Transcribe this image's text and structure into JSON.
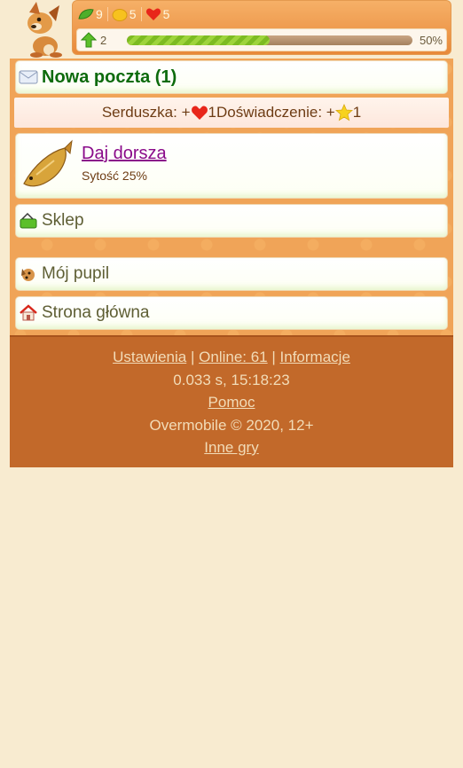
{
  "header": {
    "resources": [
      {
        "icon": "leaf-icon",
        "value": "9"
      },
      {
        "icon": "coin-icon",
        "value": "5"
      },
      {
        "icon": "heart-icon",
        "value": "5"
      }
    ],
    "level": "2",
    "progress_percent": 50,
    "progress_label": "50%"
  },
  "mail": {
    "title": "Nowa poczta (1)"
  },
  "notice": {
    "prefix": "Serduszka: +",
    "hearts": "1",
    "middle": " Doświadczenie: +",
    "exp": "1"
  },
  "food": {
    "title": "Daj dorsza",
    "subtitle": "Sytość 25%"
  },
  "menu": {
    "shop": "Sklep",
    "pet": "Mój pupil",
    "home": "Strona główna"
  },
  "footer": {
    "settings": "Ustawienia",
    "separator": "|",
    "online": "Online: 61",
    "info": "Informacje",
    "timing": "0.033 s, 15:18:23",
    "help": "Pomoc",
    "copyright": "Overmobile © 2020, 12+",
    "other_games": "Inne gry"
  },
  "colors": {
    "accent": "#f0a458",
    "footer_bg": "#c2692a",
    "mail_title": "#0d6b0d",
    "link_purple": "#8a0a8a"
  }
}
